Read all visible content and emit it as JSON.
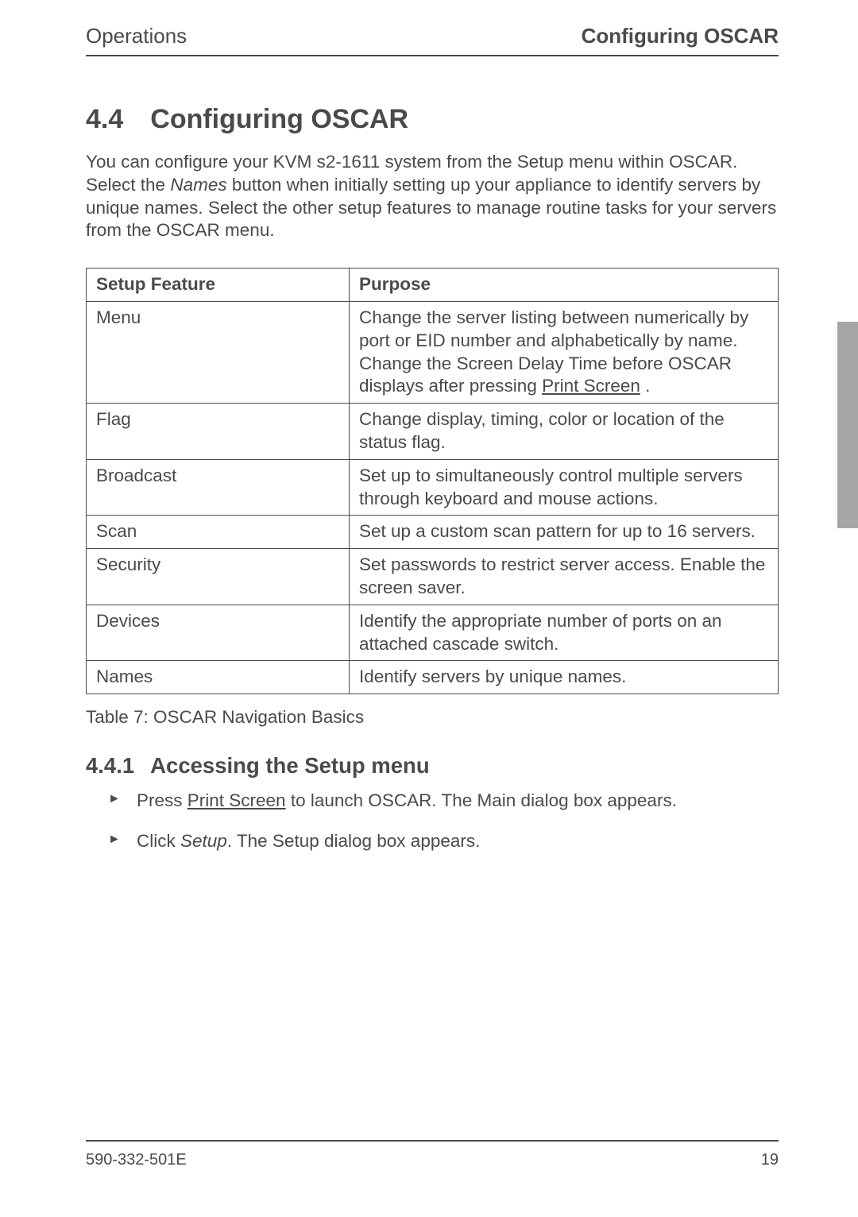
{
  "header": {
    "left": "Operations",
    "right": "Configuring OSCAR"
  },
  "section": {
    "number": "4.4",
    "title": "Configuring OSCAR"
  },
  "intro": {
    "part1": "You can configure your KVM s2-1611 system from the Setup menu within OSCAR. Select the ",
    "italic1": "Names",
    "part2": " button when initially setting up your appliance to identify servers by unique names. Select the other setup features to manage routine tasks for your servers from the OSCAR menu."
  },
  "table": {
    "headers": {
      "col1": "Setup Feature",
      "col2": "Purpose"
    },
    "rows": [
      {
        "feature": "Menu",
        "purpose_pre": "Change the server listing between numerically by port or EID number and alphabetically by name. Change the Screen Delay Time before OSCAR displays after pressing ",
        "purpose_underline": "Print Screen",
        "purpose_post": " ."
      },
      {
        "feature": "Flag",
        "purpose": "Change display, timing, color or location of the status flag."
      },
      {
        "feature": "Broadcast",
        "purpose": "Set up to simultaneously control multiple servers through keyboard and mouse actions."
      },
      {
        "feature": "Scan",
        "purpose": "Set up a custom scan pattern for up to 16 servers."
      },
      {
        "feature": "Security",
        "purpose": "Set passwords to restrict server access. Enable the screen saver."
      },
      {
        "feature": "Devices",
        "purpose": "Identify the appropriate number of ports on an attached cascade switch."
      },
      {
        "feature": "Names",
        "purpose": "Identify servers by unique names."
      }
    ]
  },
  "caption": "Table 7: OSCAR Navigation Basics",
  "subsection": {
    "number": "4.4.1",
    "title": "Accessing the Setup menu"
  },
  "steps": [
    {
      "pre": "Press ",
      "underline": "Print Screen",
      "post": " to launch OSCAR. The Main dialog box appears."
    },
    {
      "pre": "Click ",
      "italic": "Setup",
      "post": ". The Setup dialog box appears."
    }
  ],
  "footer": {
    "left": "590-332-501E",
    "right": "19"
  }
}
